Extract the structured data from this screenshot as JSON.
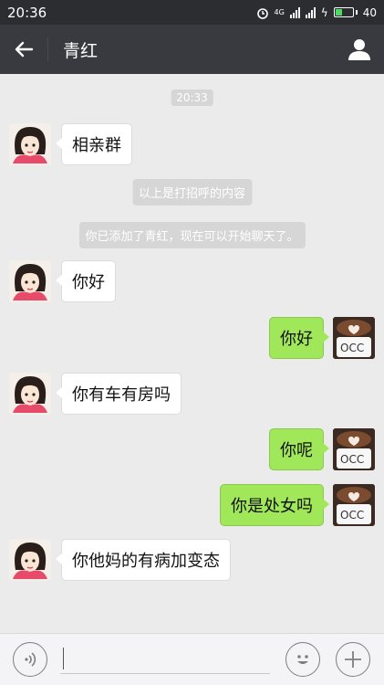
{
  "status_bar": {
    "time": "20:36",
    "network": "4G",
    "battery": "40"
  },
  "nav": {
    "back_icon": "arrow-left-icon",
    "title": "青红",
    "profile_icon": "person-icon"
  },
  "chat": {
    "timestamp": "20:33",
    "notices": [
      "以上是打招呼的内容",
      "你已添加了青红，现在可以开始聊天了。"
    ],
    "messages": [
      {
        "side": "in",
        "text": "相亲群"
      },
      {
        "side": "in",
        "text": "你好"
      },
      {
        "side": "out",
        "text": "你好"
      },
      {
        "side": "in",
        "text": "你有车有房吗"
      },
      {
        "side": "out",
        "text": "你呢"
      },
      {
        "side": "out",
        "text": "你是处女吗"
      },
      {
        "side": "in",
        "text": "你他妈的有病加变态"
      }
    ]
  },
  "input_bar": {
    "voice_icon": "voice-icon",
    "text_value": "",
    "emoji_icon": "emoji-icon",
    "plus_icon": "plus-icon"
  },
  "colors": {
    "nav_bg": "#393a3f",
    "out_bubble": "#a0e75a",
    "chat_bg": "#ebebeb"
  }
}
